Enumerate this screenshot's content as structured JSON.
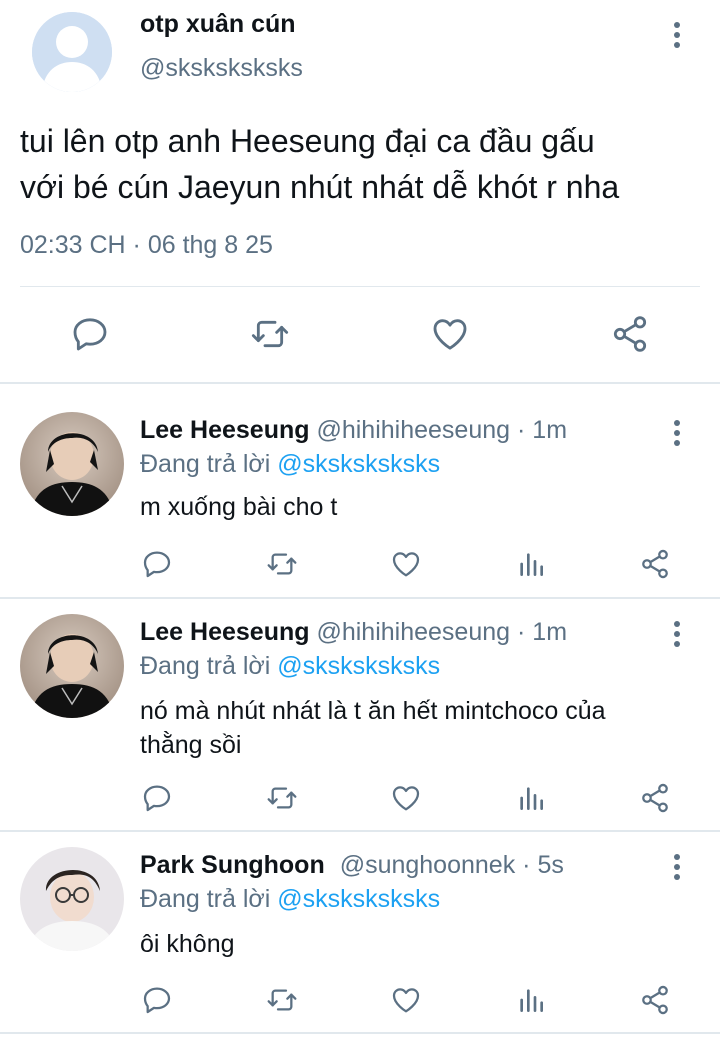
{
  "tweet": {
    "display_name": "otp xuân cún",
    "handle": "@sksksksksks",
    "text_line1": "tui lên otp anh Heeseung đại ca đầu gấu",
    "text_line2": "với bé cún Jaeyun nhút nhát dễ khót r nha",
    "timestamp": "02:33 CH · 06 thg 8 25",
    "icons": [
      "reply-icon",
      "retweet-icon",
      "like-icon",
      "share-icon"
    ],
    "icon_color": "#5b7083"
  },
  "replies": [
    {
      "display_name": "Lee Heeseung",
      "handle": "@hihihiheeseung",
      "separator": "·",
      "time": "1m",
      "replying_prefix": "Đang trả lời",
      "replying_to": "@sksksksksks",
      "text_lines": [
        "m xuống bài cho t"
      ]
    },
    {
      "display_name": "Lee Heeseung",
      "handle": "@hihihiheeseung",
      "separator": "·",
      "time": "1m",
      "replying_prefix": "Đang trả lời",
      "replying_to": "@sksksksksks",
      "text_lines": [
        "nó mà nhút nhát là t ăn hết mintchoco của",
        "thằng sồi"
      ]
    },
    {
      "display_name": "Park Sunghoon",
      "handle": "@sunghoonnek",
      "separator": "·",
      "time": "5s",
      "replying_prefix": "Đang trả lời",
      "replying_to": "@sksksksksks",
      "text_lines": [
        "ôi không"
      ]
    }
  ],
  "colors": {
    "text": "#0f1419",
    "secondary": "#5b7083",
    "mention": "#1da1f2",
    "divider": "#e1e8ed"
  }
}
